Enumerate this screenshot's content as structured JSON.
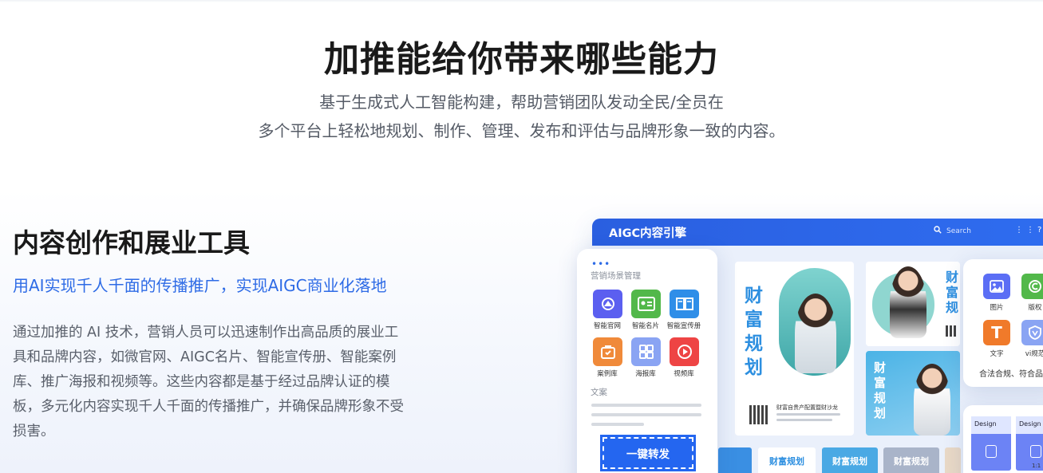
{
  "hero": {
    "title": "加推能给你带来哪些能力",
    "subtitle_line1": "基于生成式人工智能构建，帮助营销团队发动全民/全员在",
    "subtitle_line2": "多个平台上轻松地规划、制作、管理、发布和评估与品牌形象一致的内容。"
  },
  "feature": {
    "title": "内容创作和展业工具",
    "tagline": "用AI实现千人千面的传播推广，实现AIGC商业化落地",
    "body_line1": "通过加推的 AI 技术，营销人员可以迅速制作出高品质的展业工",
    "body_line2": "具和品牌内容，如微官网、AIGC名片、智能宣传册、智能案例",
    "body_line3": "库、推广海报和视频等。这些内容都是基于经过品牌认证的模",
    "body_line4": "板，多元化内容实现千人千面的传播推广，并确保品牌形象不受",
    "body_line5": "损害。"
  },
  "mockup": {
    "window_title": "AIGC内容引擎",
    "search_placeholder": "Search",
    "poster_headline": "财富规划",
    "poster_headline_short": "财富规",
    "poster_caption": "财富自贵产配置暨财沙龙",
    "strip_labels": [
      "财富规划",
      "财富规划",
      "财富规划"
    ],
    "card": {
      "section_title": "营销场景管理",
      "tools": [
        {
          "label": "智能官网",
          "icon": "website-icon",
          "color": "#5b5ff0"
        },
        {
          "label": "智能名片",
          "icon": "business-card-icon",
          "color": "#52b84a"
        },
        {
          "label": "智能宣传册",
          "icon": "brochure-icon",
          "color": "#2f8ee8"
        },
        {
          "label": "案例库",
          "icon": "case-library-icon",
          "color": "#f08a3a"
        },
        {
          "label": "海报库",
          "icon": "poster-library-icon",
          "color": "#8aa4f3"
        },
        {
          "label": "视频库",
          "icon": "video-library-icon",
          "color": "#ee4444"
        }
      ],
      "copy_label": "文案",
      "cta_label": "一键转发"
    },
    "right_card": {
      "tools": [
        {
          "label": "图片",
          "icon": "image-icon",
          "color": "#5b6ef5"
        },
        {
          "label": "版权",
          "icon": "copyright-icon",
          "color": "#52b84a"
        },
        {
          "label": "文字",
          "icon": "text-icon",
          "color": "#f07a2a"
        },
        {
          "label": "vi规范",
          "icon": "vi-shield-icon",
          "color": "#8aa4f3"
        }
      ],
      "footer": "合法合规、符合品"
    },
    "design_card": {
      "thumb_label": "Design",
      "ratio": "1:1"
    }
  }
}
